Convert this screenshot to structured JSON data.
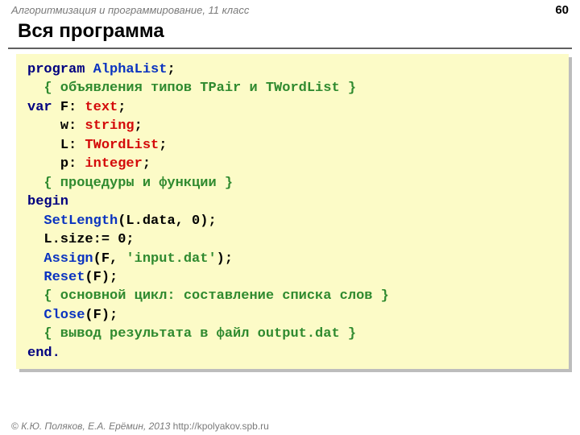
{
  "header": {
    "course": "Алгоритмизация и программирование, 11 класс",
    "page": "60"
  },
  "title": "Вся программа",
  "code": {
    "l1": {
      "kw": "program",
      "sp": " ",
      "id": "AlphaList",
      "punc": ";"
    },
    "l2": {
      "pad": "  ",
      "cmt": "{ объявления типов TPair и TWordList }"
    },
    "l3": {
      "kw": "var",
      "sp": " ",
      "var": "F",
      "colon": ": ",
      "type": "text",
      "punc": ";"
    },
    "l4": {
      "pad": "    ",
      "var": "w",
      "colon": ": ",
      "type": "string",
      "punc": ";"
    },
    "l5": {
      "pad": "    ",
      "var": "L",
      "colon": ": ",
      "type": "TWordList",
      "punc": ";"
    },
    "l6": {
      "pad": "    ",
      "var": "p",
      "colon": ": ",
      "type": "integer",
      "punc": ";"
    },
    "l7": {
      "pad": "  ",
      "cmt": "{ процедуры и функции }"
    },
    "l8": {
      "kw": "begin"
    },
    "l9": {
      "pad": "  ",
      "fn": "SetLength",
      "args": "(L.data, 0);"
    },
    "l10": {
      "pad": "  ",
      "stmt": "L.size:= 0;"
    },
    "l11": {
      "pad": "  ",
      "fn": "Assign",
      "lp": "(F, ",
      "str": "'input.dat'",
      "rp": ");"
    },
    "l12": {
      "pad": "  ",
      "fn": "Reset",
      "args": "(F);"
    },
    "l13": {
      "pad": "  ",
      "cmt": "{ основной цикл: составление списка слов }"
    },
    "l14": {
      "pad": "  ",
      "fn": "Close",
      "args": "(F);"
    },
    "l15": {
      "pad": "  ",
      "cmt": "{ вывод результата в файл output.dat }"
    },
    "l16": {
      "kw": "end."
    }
  },
  "footer": {
    "copyright": "© ",
    "authors": "К.Ю. Поляков, Е.А. Ерёмин, 2013",
    "sep": "     ",
    "url": "http://kpolyakov.spb.ru"
  }
}
